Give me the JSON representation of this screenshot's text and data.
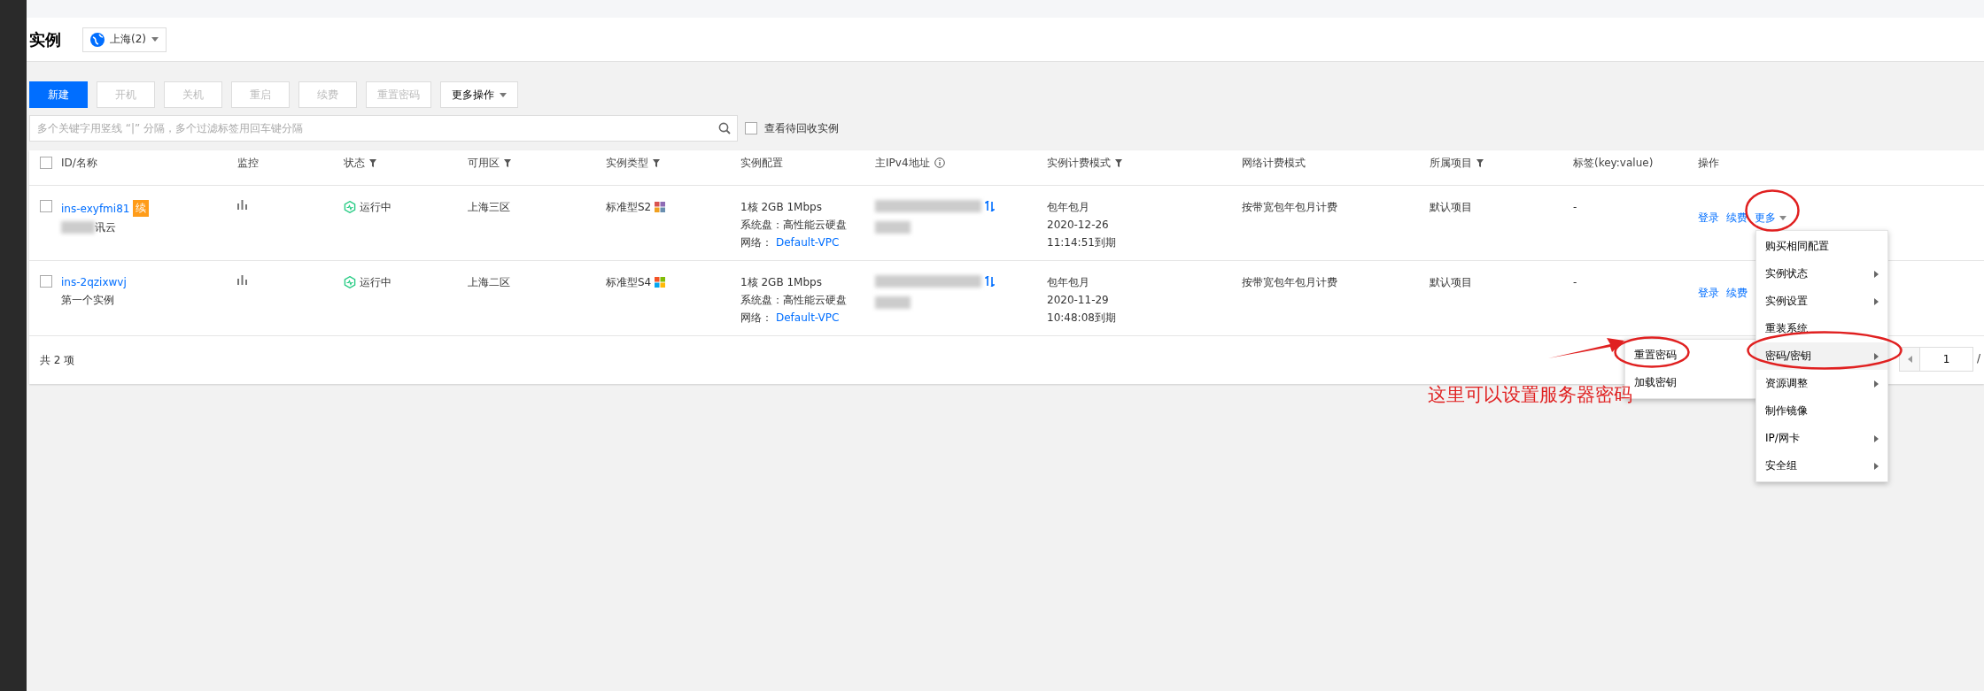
{
  "header": {
    "title": "实例",
    "region": {
      "label": "上海(2)"
    }
  },
  "toolbar": {
    "buttons": [
      {
        "label": "新建",
        "primary": true,
        "disabled": false
      },
      {
        "label": "开机",
        "primary": false,
        "disabled": true
      },
      {
        "label": "关机",
        "primary": false,
        "disabled": true
      },
      {
        "label": "重启",
        "primary": false,
        "disabled": true
      },
      {
        "label": "续费",
        "primary": false,
        "disabled": true
      },
      {
        "label": "重置密码",
        "primary": false,
        "disabled": true
      }
    ],
    "more": {
      "label": "更多操作"
    }
  },
  "search": {
    "placeholder": "多个关键字用竖线 “|” 分隔，多个过滤标签用回车键分隔",
    "recycle": {
      "label": "查看待回收实例",
      "checked": false
    }
  },
  "table": {
    "select_all": {
      "checked": false
    },
    "columns": [
      {
        "label": "ID/名称",
        "filter": false,
        "info": false
      },
      {
        "label": "监控",
        "filter": false,
        "info": false
      },
      {
        "label": "状态",
        "filter": true,
        "info": false
      },
      {
        "label": "可用区",
        "filter": true,
        "info": false
      },
      {
        "label": "实例类型",
        "filter": true,
        "info": false
      },
      {
        "label": "实例配置",
        "filter": false,
        "info": false
      },
      {
        "label": "主IPv4地址",
        "filter": false,
        "info": true
      },
      {
        "label": "实例计费模式",
        "filter": true,
        "info": false
      },
      {
        "label": "网络计费模式",
        "filter": false,
        "info": false
      },
      {
        "label": "所属项目",
        "filter": true,
        "info": false
      },
      {
        "label": "标签(key:value)",
        "filter": false,
        "info": false
      },
      {
        "label": "操作",
        "filter": false,
        "info": false
      }
    ],
    "rows": [
      {
        "selected": false,
        "id": "ins-exyfmi81",
        "badge": "续",
        "name": "讯云",
        "name_redacted": true,
        "status": "运行中",
        "zone": "上海三区",
        "type": "标准型S2",
        "type_logo": {
          "kind": "mixed"
        },
        "config": [
          "1核 2GB 1Mbps",
          "系统盘：高性能云硬盘"
        ],
        "network_label": "网络：",
        "network": "Default-VPC",
        "billing": [
          "包年包月",
          "2020-12-26",
          "11:14:51到期"
        ],
        "net_billing": "按带宽包年包月计费",
        "project": "默认项目",
        "tag": "-",
        "actions": [
          "登录",
          "续费"
        ],
        "more": "更多"
      },
      {
        "selected": false,
        "id": "ins-2qzixwvj",
        "name": "第一个实例",
        "name_redacted": false,
        "status": "运行中",
        "zone": "上海二区",
        "type": "标准型S4",
        "type_logo": {
          "kind": "windows"
        },
        "config": [
          "1核 2GB 1Mbps",
          "系统盘：高性能云硬盘"
        ],
        "network_label": "网络：",
        "network": "Default-VPC",
        "billing": [
          "包年包月",
          "2020-11-29",
          "10:48:08到期"
        ],
        "net_billing": "按带宽包年包月计费",
        "project": "默认项目",
        "tag": "-",
        "actions": [
          "登录",
          "续费"
        ]
      }
    ],
    "total": "共 2 项"
  },
  "pagination": {
    "page": "1",
    "separator": "/"
  },
  "menu": {
    "items": [
      {
        "label": "购买相同配置",
        "submenu": false,
        "selected": false
      },
      {
        "label": "实例状态",
        "submenu": true,
        "selected": false
      },
      {
        "label": "实例设置",
        "submenu": true,
        "selected": false
      },
      {
        "label": "重装系统",
        "submenu": false,
        "selected": false
      },
      {
        "label": "密码/密钥",
        "submenu": true,
        "selected": true
      },
      {
        "label": "资源调整",
        "submenu": true,
        "selected": false
      },
      {
        "label": "制作镜像",
        "submenu": false,
        "selected": false
      },
      {
        "label": "IP/网卡",
        "submenu": true,
        "selected": false
      },
      {
        "label": "安全组",
        "submenu": true,
        "selected": false
      }
    ],
    "submenu": [
      {
        "label": "重置密码"
      },
      {
        "label": "加载密钥"
      }
    ]
  },
  "annotation": {
    "text": "这里可以设置服务器密码"
  }
}
